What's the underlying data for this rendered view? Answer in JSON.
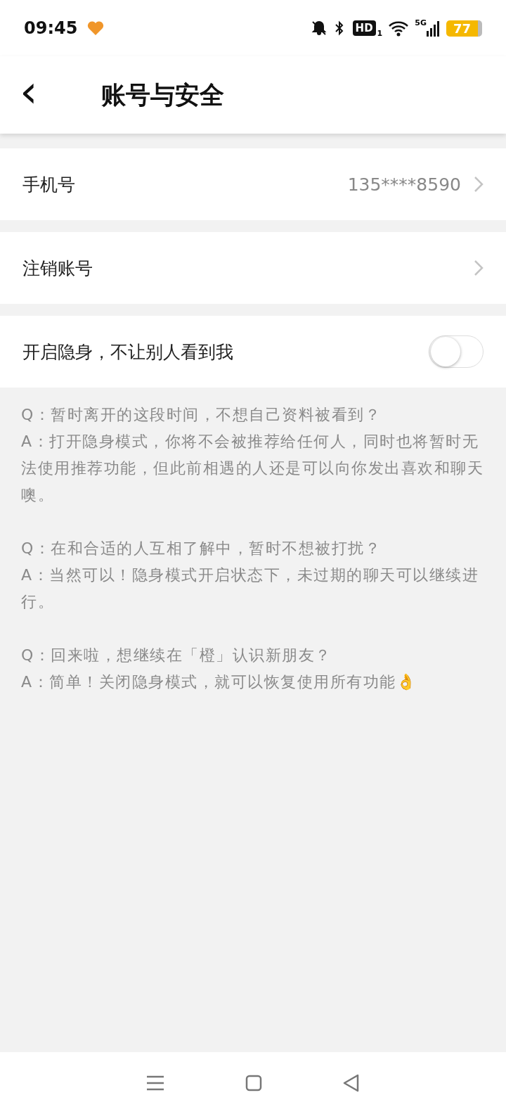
{
  "status_bar": {
    "time": "09:45",
    "hd": "HD",
    "hd_sub": "1",
    "network": "5G",
    "battery": "77"
  },
  "header": {
    "back": "‹",
    "title": "账号与安全"
  },
  "rows": [
    {
      "kind": "link",
      "label": "手机号",
      "value": "135****8590"
    },
    {
      "kind": "link",
      "label": "注销账号"
    },
    {
      "kind": "toggle",
      "label": "开启隐身，不让别人看到我",
      "on": false
    }
  ],
  "faq": [
    {
      "q": "Q：暂时离开的这段时间，不想自己资料被看到？",
      "a": "A：打开隐身模式，你将不会被推荐给任何人，同时也将暂时无法使用推荐功能，但此前相遇的人还是可以向你发出喜欢和聊天噢。"
    },
    {
      "q": "Q：在和合适的人互相了解中，暂时不想被打扰？",
      "a": "A：当然可以！隐身模式开启状态下，未过期的聊天可以继续进行。"
    },
    {
      "q": "Q：回来啦，想继续在「橙」认识新朋友？",
      "a": "A：简单！关闭隐身模式，就可以恢复使用所有功能👌"
    }
  ]
}
